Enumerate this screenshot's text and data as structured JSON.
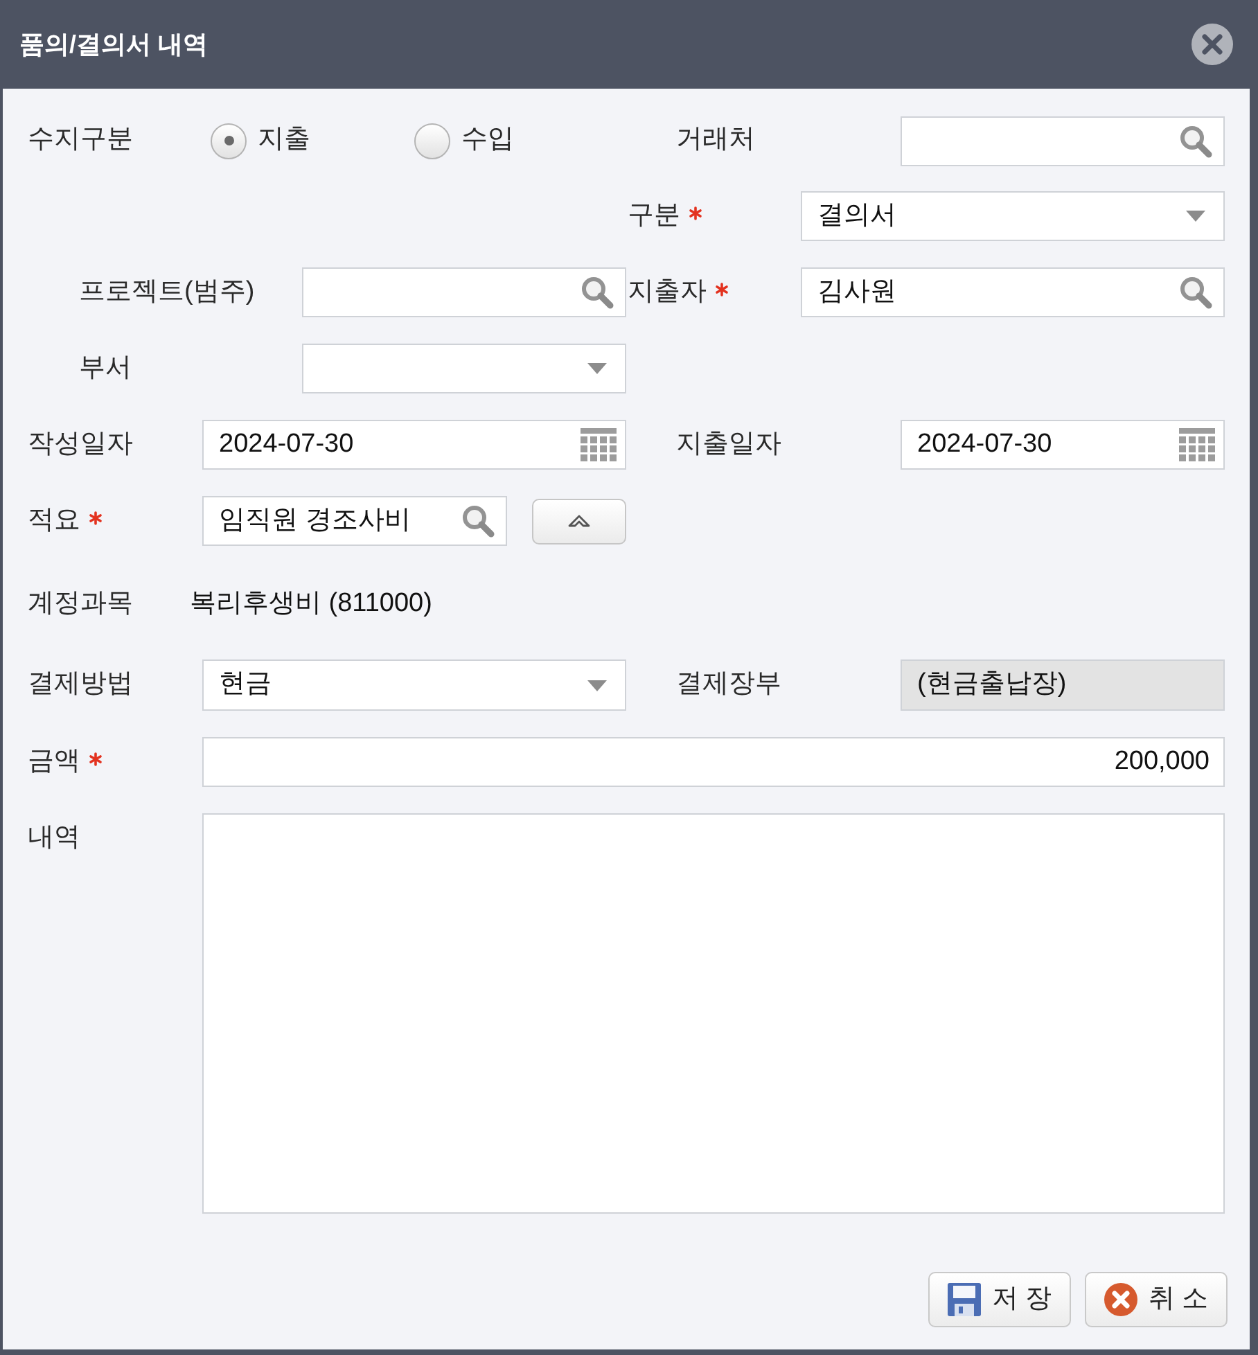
{
  "window": {
    "title": "품의/결의서 내역"
  },
  "income_type": {
    "label": "수지구분",
    "options": [
      {
        "label": "지출",
        "selected": true
      },
      {
        "label": "수입",
        "selected": false
      }
    ]
  },
  "vendor": {
    "label": "거래처"
  },
  "category": {
    "label": "구분",
    "required": true,
    "value": "결의서"
  },
  "project": {
    "label": "프로젝트(범주)"
  },
  "spender": {
    "label": "지출자",
    "required": true,
    "value": "김사원"
  },
  "department": {
    "label": "부서"
  },
  "written_date": {
    "label": "작성일자",
    "value": "2024-07-30"
  },
  "spend_date": {
    "label": "지출일자",
    "value": "2024-07-30"
  },
  "summary": {
    "label": "적요",
    "required": true,
    "value": "임직원 경조사비"
  },
  "account": {
    "label": "계정과목",
    "value": "복리후생비 (811000)"
  },
  "payment_method": {
    "label": "결제방법",
    "value": "현금"
  },
  "payment_book": {
    "label": "결제장부",
    "value": "(현금출납장)",
    "disabled": true
  },
  "amount": {
    "label": "금액",
    "required": true,
    "value": "200,000"
  },
  "details": {
    "label": "내역"
  },
  "buttons": [
    {
      "label": "저 장",
      "kind": "save"
    },
    {
      "label": "취 소",
      "kind": "cancel"
    }
  ]
}
